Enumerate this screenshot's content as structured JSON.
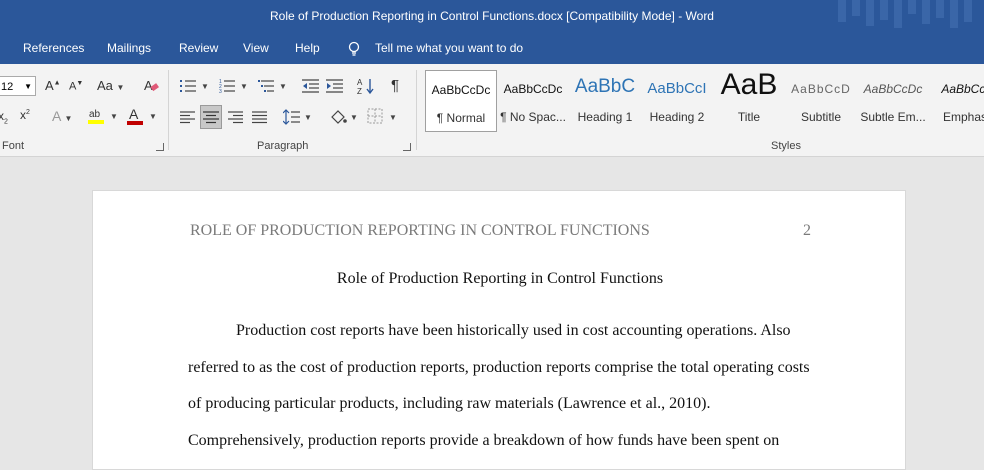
{
  "titlebar": {
    "title": "Role of Production Reporting in Control Functions.docx [Compatibility Mode]  -  Word"
  },
  "menu": {
    "references": "References",
    "mailings": "Mailings",
    "review": "Review",
    "view": "View",
    "help": "Help",
    "tell_me": "Tell me what you want to do"
  },
  "ribbon": {
    "font_size": "12",
    "font_group_label": "Font",
    "paragraph_group_label": "Paragraph",
    "styles_group_label": "Styles",
    "font_color": "#c00000",
    "highlight_color": "#ffff00",
    "styles": [
      {
        "preview": "AaBbCcDc",
        "name": "¶ Normal"
      },
      {
        "preview": "AaBbCcDc",
        "name": "¶ No Spac..."
      },
      {
        "preview": "AaBbC",
        "name": "Heading 1"
      },
      {
        "preview": "AaBbCcI",
        "name": "Heading 2"
      },
      {
        "preview": "AaB",
        "name": "Title"
      },
      {
        "preview": "AaBbCcD",
        "name": "Subtitle"
      },
      {
        "preview": "AaBbCcDc",
        "name": "Subtle Em..."
      },
      {
        "preview": "AaBbCcI",
        "name": "Emphas"
      }
    ]
  },
  "document": {
    "header": "ROLE OF PRODUCTION REPORTING IN CONTROL FUNCTIONS",
    "page_number": "2",
    "title": "Role of Production Reporting in Control Functions",
    "lines": [
      "Production cost reports have been historically used in cost accounting operations. Also",
      "referred to as the cost of production reports, production reports comprise the total operating costs",
      "of producing particular products, including raw materials (Lawrence et al., 2010).",
      "Comprehensively, production reports provide a breakdown of how funds have been spent on"
    ]
  }
}
